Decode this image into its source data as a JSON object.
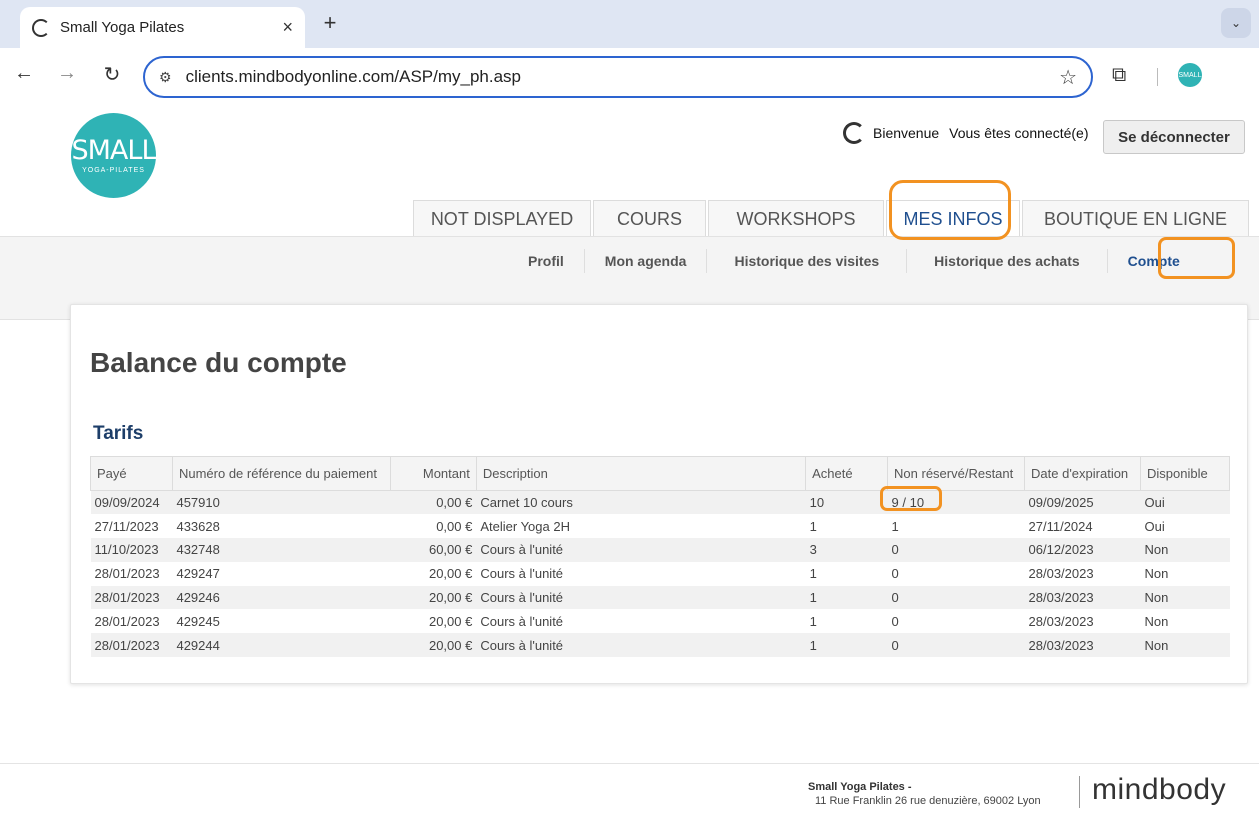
{
  "browser": {
    "tab_title": "Small Yoga Pilates",
    "tab_close": "×",
    "new_tab": "+",
    "dropdown": "⌄",
    "url": "clients.mindbodyonline.com/ASP/my_ph.asp",
    "back": "←",
    "forward": "→",
    "reload": "↻",
    "star": "☆",
    "site_info_icon": "⚙",
    "extensions_icon": "⧉",
    "profile_avatar_text": "SMALL"
  },
  "header": {
    "logo_main": "SMALL",
    "logo_sub": "YOGA-PILATES",
    "welcome": "Bienvenue",
    "connected": "Vous êtes connecté(e)",
    "logout": "Se déconnecter"
  },
  "main_tabs": [
    {
      "label": "NOT DISPLAYED"
    },
    {
      "label": "COURS"
    },
    {
      "label": "WORKSHOPS"
    },
    {
      "label": "MES INFOS",
      "active": true
    },
    {
      "label": "BOUTIQUE EN LIGNE"
    }
  ],
  "sub_nav": [
    {
      "label": "Profil"
    },
    {
      "label": "Mon agenda"
    },
    {
      "label": "Historique des visites"
    },
    {
      "label": "Historique des achats"
    },
    {
      "label": "Compte",
      "active": true
    }
  ],
  "content": {
    "title": "Balance du compte",
    "section": "Tarifs",
    "columns": [
      "Payé",
      "Numéro de référence du paiement",
      "Montant",
      "Description",
      "Acheté",
      "Non réservé/Restant",
      "Date d'expiration",
      "Disponible"
    ],
    "rows": [
      [
        "09/09/2024",
        "457910",
        "0,00 €",
        "Carnet 10 cours",
        "10",
        "9 / 10",
        "09/09/2025",
        "Oui"
      ],
      [
        "27/11/2023",
        "433628",
        "0,00 €",
        "Atelier Yoga 2H",
        "1",
        "1",
        "27/11/2024",
        "Oui"
      ],
      [
        "11/10/2023",
        "432748",
        "60,00 €",
        "Cours à l'unité",
        "3",
        "0",
        "06/12/2023",
        "Non"
      ],
      [
        "28/01/2023",
        "429247",
        "20,00 €",
        "Cours à l'unité",
        "1",
        "0",
        "28/03/2023",
        "Non"
      ],
      [
        "28/01/2023",
        "429246",
        "20,00 €",
        "Cours à l'unité",
        "1",
        "0",
        "28/03/2023",
        "Non"
      ],
      [
        "28/01/2023",
        "429245",
        "20,00 €",
        "Cours à l'unité",
        "1",
        "0",
        "28/03/2023",
        "Non"
      ],
      [
        "28/01/2023",
        "429244",
        "20,00 €",
        "Cours à l'unité",
        "1",
        "0",
        "28/03/2023",
        "Non"
      ]
    ]
  },
  "footer": {
    "name": "Small Yoga Pilates -",
    "address": "11 Rue Franklin 26 rue denuzière, 69002 Lyon",
    "brand": "mindbody"
  },
  "colors": {
    "brand_teal": "#2fb3b5",
    "annotation_orange": "#f29221",
    "link_blue": "#1f4f8f"
  }
}
